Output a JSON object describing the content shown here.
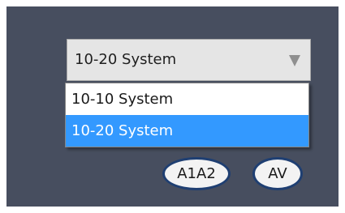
{
  "montage_select": {
    "selected_value": "10-20 System",
    "options": [
      "10-10 System",
      "10-20 System"
    ],
    "highlighted_index": 1
  },
  "buttons": {
    "a1a2_label": "A1A2",
    "av_label": "AV"
  },
  "colors": {
    "panel_background": "#474e5f",
    "highlight": "#3399ff",
    "button_border": "#1f3f72"
  }
}
